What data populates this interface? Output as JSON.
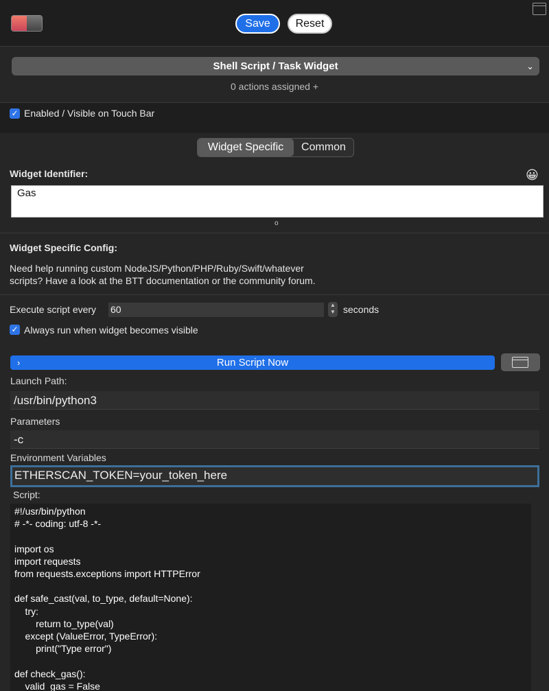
{
  "toolbar": {
    "save_label": "Save",
    "reset_label": "Reset"
  },
  "trigger": {
    "type_label": "Shell Script / Task Widget",
    "actions_label": "0 actions assigned +"
  },
  "enabled": {
    "label": "Enabled / Visible on Touch Bar",
    "checked": true
  },
  "tabs": [
    {
      "label": "Widget Specific",
      "selected": true
    },
    {
      "label": "Common",
      "selected": false
    }
  ],
  "identifier": {
    "label": "Widget Identifier:",
    "value": "Gas"
  },
  "config": {
    "title": "Widget Specific Config:",
    "help_line1": "Need help running custom NodeJS/Python/PHP/Ruby/Swift/whatever",
    "help_line2": "scripts? Have a look at the BTT documentation or the community forum.",
    "execute_label": "Execute script every",
    "execute_value": "60",
    "seconds_label": "seconds",
    "always_run_label": "Always run when widget becomes visible",
    "run_now_label": "Run Script Now",
    "launch_path_label": "Launch Path:",
    "launch_path_value": "/usr/bin/python3",
    "parameters_label": "Parameters",
    "parameters_value": "-c",
    "env_label": "Environment Variables",
    "env_value": "ETHERSCAN_TOKEN=your_token_here",
    "script_label": "Script:",
    "script_lines": [
      "#!/usr/bin/python",
      "# -*- coding: utf-8 -*-",
      "",
      "import os",
      "import requests",
      "from requests.exceptions import HTTPError",
      "",
      "def safe_cast(val, to_type, default=None):",
      "    try:",
      "        return to_type(val)",
      "    except (ValueError, TypeError):",
      "        print(\"Type error\")",
      "",
      "def check_gas():",
      "    valid_gas = False"
    ]
  },
  "colors": {
    "accent": "#1f6fe8",
    "background": "#262626",
    "panel": "#1e1e1e"
  }
}
